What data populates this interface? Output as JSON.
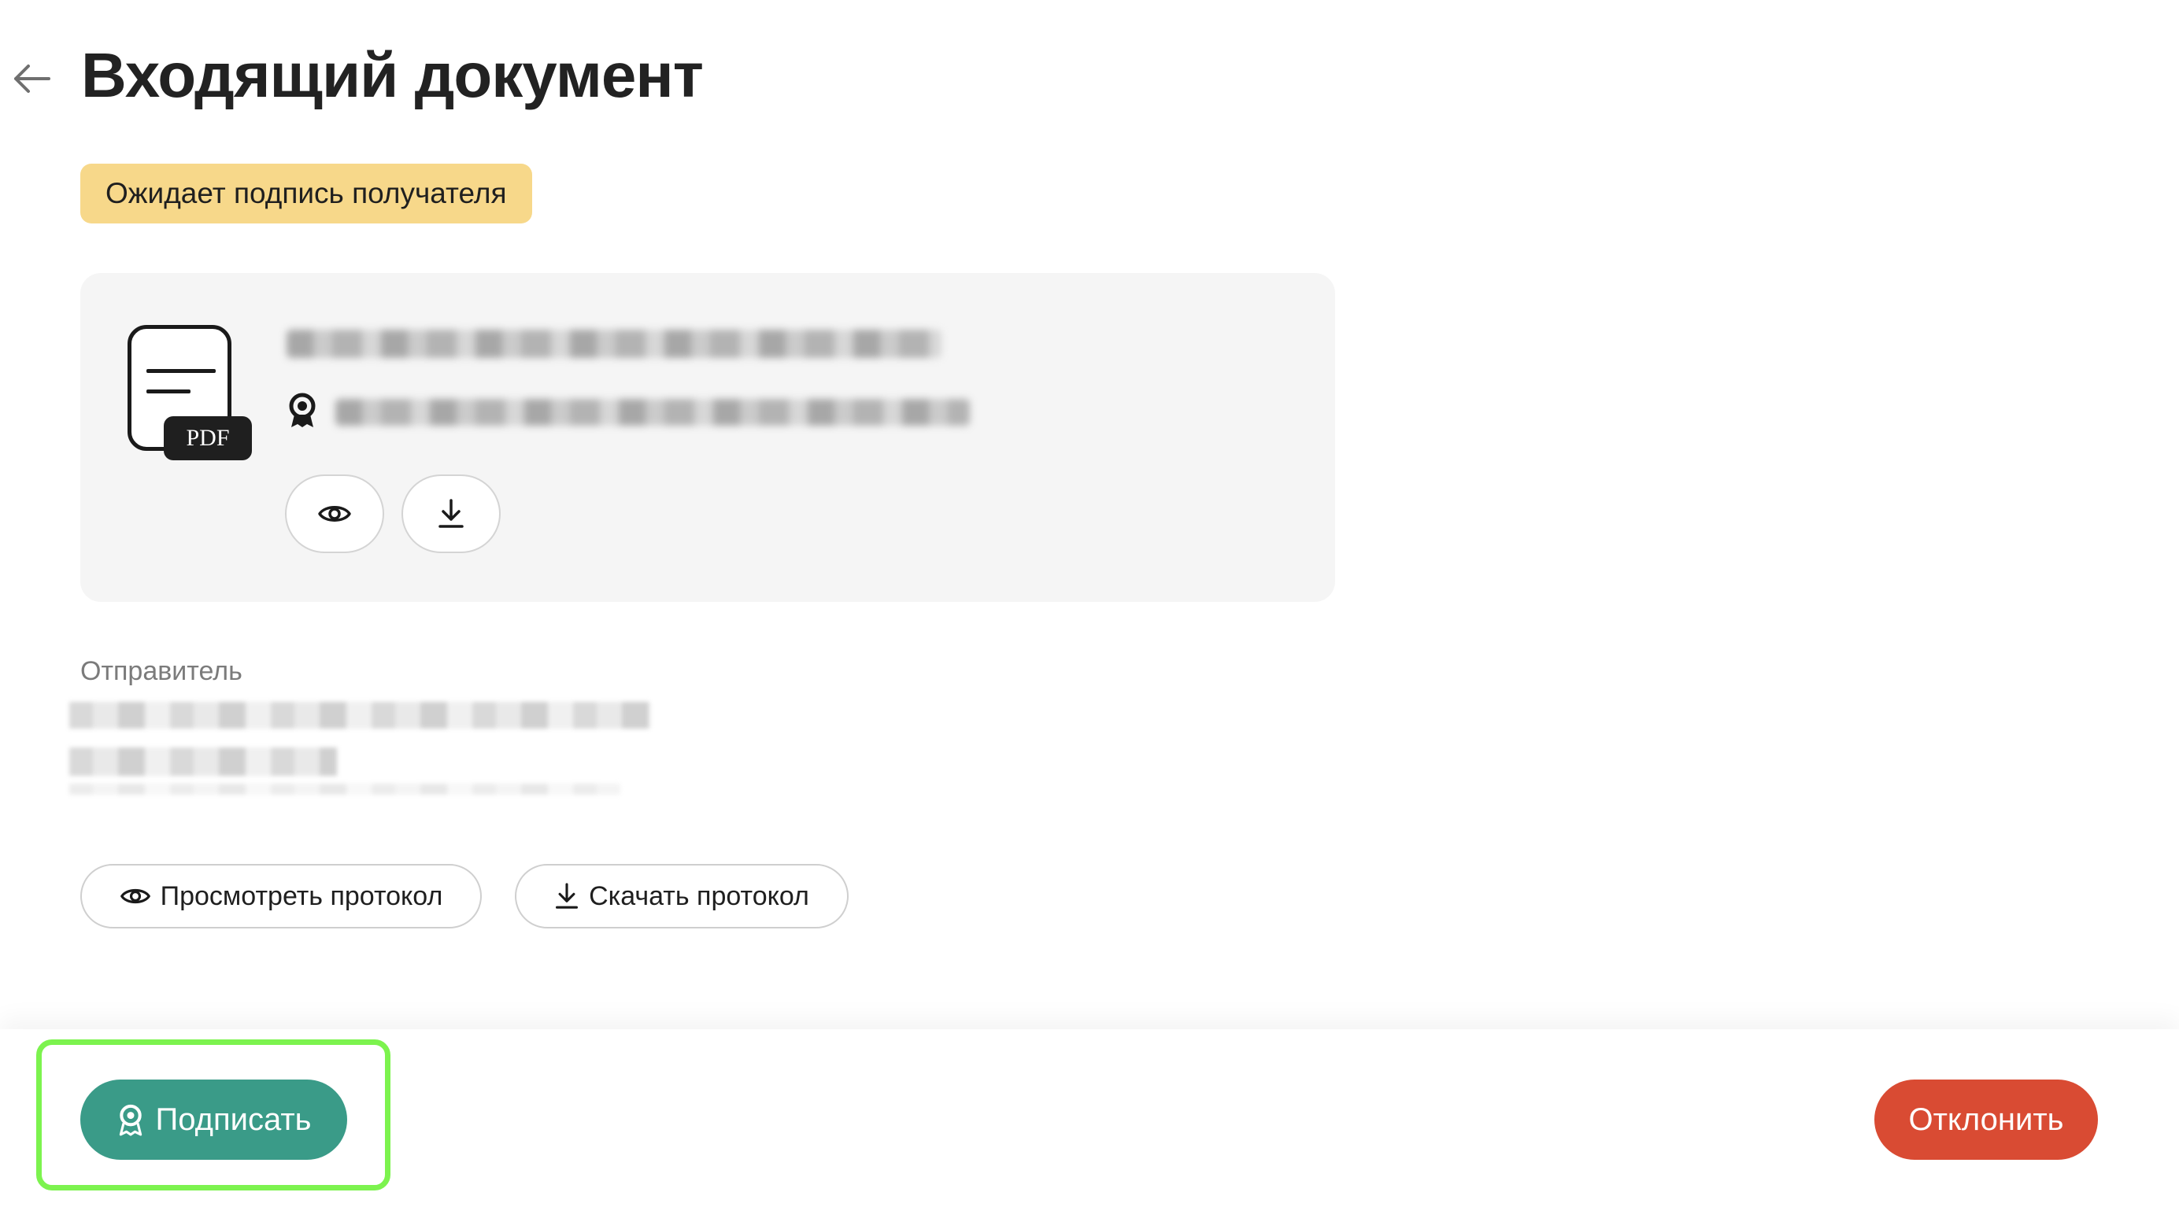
{
  "header": {
    "title": "Входящий документ",
    "back_icon": "arrow-left-icon"
  },
  "status": {
    "label": "Ожидает подпись получателя",
    "color": "#f7d88a"
  },
  "document": {
    "file_type": "PDF",
    "file_icon": "pdf-file-icon",
    "signature_icon": "seal-icon",
    "view_icon": "eye-icon",
    "download_icon": "download-icon"
  },
  "sender": {
    "label": "Отправитель"
  },
  "protocol": {
    "view_label": "Просмотреть протокол",
    "download_label": "Скачать протокол"
  },
  "footer": {
    "sign_label": "Подписать",
    "reject_label": "Отклонить",
    "sign_color": "#3a9b88",
    "reject_color": "#d94b33",
    "highlight_color": "#7cf34e"
  }
}
